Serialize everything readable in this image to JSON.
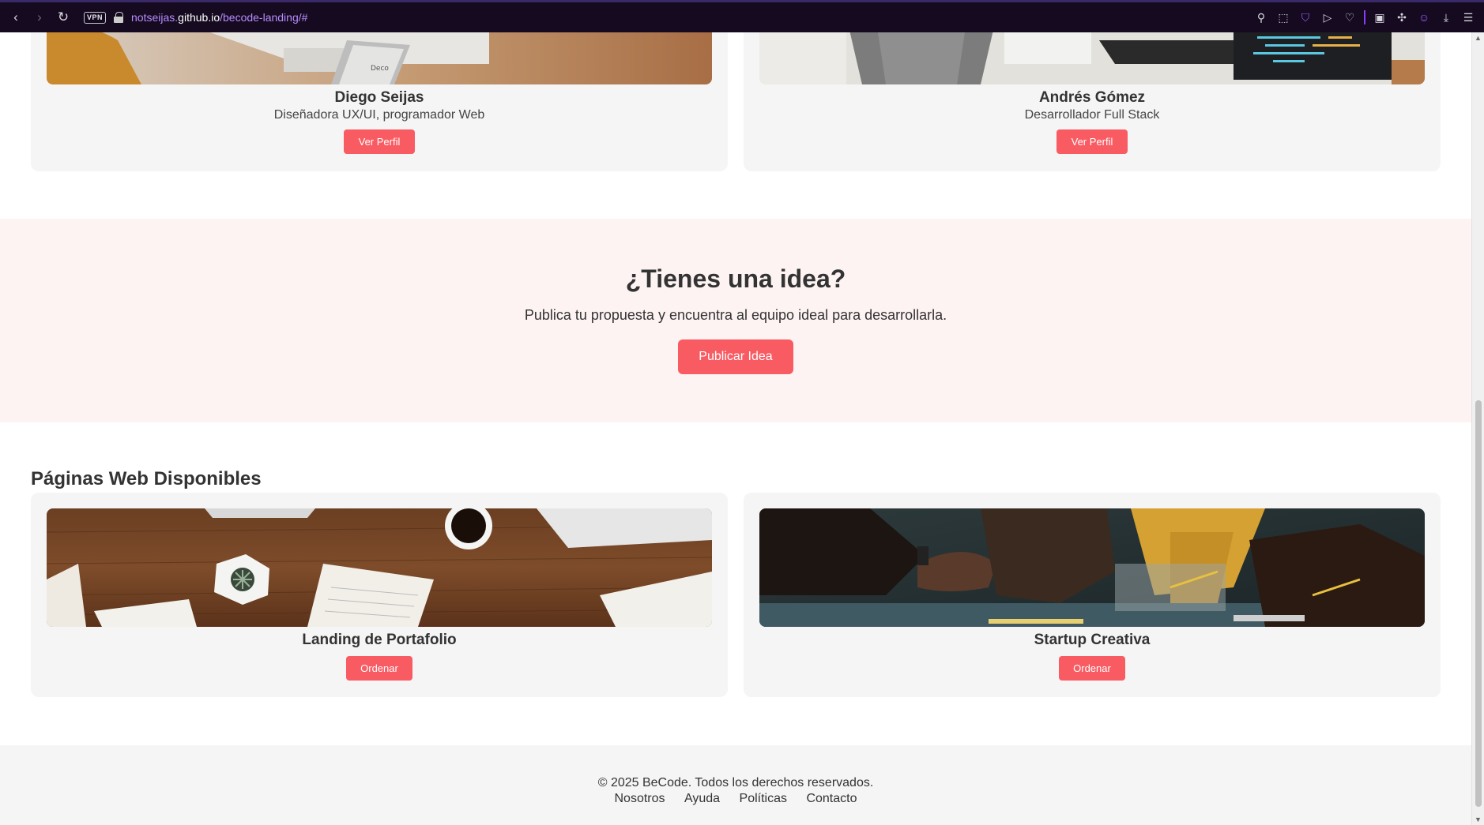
{
  "browser": {
    "url_host_prefix": "notseijas.",
    "url_host_main": "github.io",
    "url_path": "/becode-landing/#",
    "vpn_label": "VPN"
  },
  "profiles": [
    {
      "name": "Diego Seijas",
      "role": "Diseñadora UX/UI, programador Web",
      "button": "Ver Perfil"
    },
    {
      "name": "Andrés Gómez",
      "role": "Desarrollador Full Stack",
      "button": "Ver Perfil"
    }
  ],
  "cta": {
    "title": "¿Tienes una idea?",
    "subtitle": "Publica tu propuesta y encuentra al equipo ideal para desarrollarla.",
    "button": "Publicar Idea"
  },
  "pages_section": {
    "title": "Páginas Web Disponibles",
    "items": [
      {
        "name": "Landing de Portafolio",
        "button": "Ordenar"
      },
      {
        "name": "Startup Creativa",
        "button": "Ordenar"
      }
    ]
  },
  "footer": {
    "copyright": "© 2025 BeCode. Todos los derechos reservados.",
    "links": [
      "Nosotros",
      "Ayuda",
      "Políticas",
      "Contacto"
    ]
  },
  "colors": {
    "accent": "#f95b63",
    "cta_bg": "#fef3f3",
    "card_bg": "#f5f5f5",
    "chrome_bg": "#150a1f",
    "url_color": "#b78cff"
  }
}
